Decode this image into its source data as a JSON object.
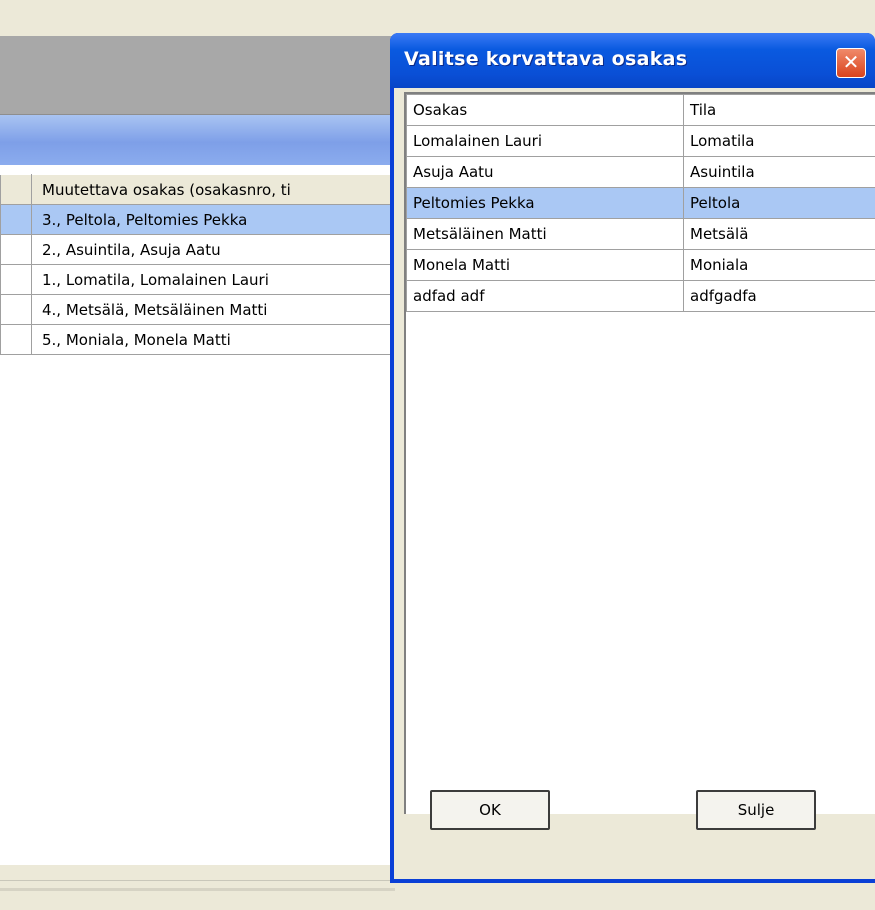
{
  "background_window": {
    "column_header": "Muutettava osakas (osakasnro, ti",
    "rows": [
      {
        "text": "3., Peltola, Peltomies Pekka",
        "selected": true
      },
      {
        "text": "2., Asuintila, Asuja Aatu",
        "selected": false
      },
      {
        "text": "1., Lomatila, Lomalainen Lauri",
        "selected": false
      },
      {
        "text": "4., Metsälä, Metsäläinen Matti",
        "selected": false
      },
      {
        "text": "5., Moniala, Monela Matti",
        "selected": false
      }
    ]
  },
  "dialog": {
    "title": "Valitse korvattava osakas",
    "close_glyph": "✕",
    "columns": [
      "Osakas",
      "Tila"
    ],
    "rows": [
      {
        "osakas": "Lomalainen Lauri",
        "tila": "Lomatila",
        "selected": false
      },
      {
        "osakas": "Asuja Aatu",
        "tila": "Asuintila",
        "selected": false
      },
      {
        "osakas": "Peltomies Pekka",
        "tila": "Peltola",
        "selected": true
      },
      {
        "osakas": "Metsäläinen Matti",
        "tila": "Metsälä",
        "selected": false
      },
      {
        "osakas": "Monela Matti",
        "tila": "Moniala",
        "selected": false
      },
      {
        "osakas": "adfad adf",
        "tila": "adfgadfa",
        "selected": false
      }
    ],
    "ok_label": "OK",
    "close_label": "Sulje"
  },
  "colors": {
    "title_blue": "#0a4fd6",
    "selection": "#aac8f4",
    "close_red": "#d9431e"
  }
}
